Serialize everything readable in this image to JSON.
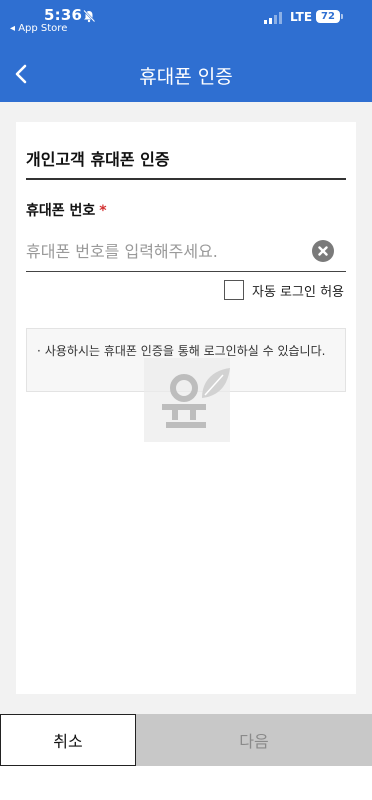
{
  "status_bar": {
    "time": "5:36",
    "back_app": "◂ App Store",
    "network": "LTE",
    "battery": "72"
  },
  "header": {
    "title": "휴대폰 인증"
  },
  "form": {
    "section_title": "개인고객 휴대폰 인증",
    "phone_label": "휴대폰 번호",
    "required_mark": "*",
    "phone_placeholder": "휴대폰 번호를 입력해주세요.",
    "phone_value": "",
    "auto_login_label": "자동 로그인 허용",
    "auto_login_checked": false,
    "notice_bullet": "·",
    "notice_text": "사용하시는 휴대폰 인증을 통해 로그인하실 수 있습니다."
  },
  "actions": {
    "cancel_label": "취소",
    "next_label": "다음",
    "next_enabled": false
  },
  "colors": {
    "header_blue": "#2f6fd1",
    "required_red": "#d32f2f",
    "disabled_button": "#c8c8c8"
  },
  "icons": [
    "back-chevron-icon",
    "bell-muted-icon",
    "signal-icon",
    "battery-icon",
    "clear-icon",
    "leaf-watermark-icon"
  ]
}
